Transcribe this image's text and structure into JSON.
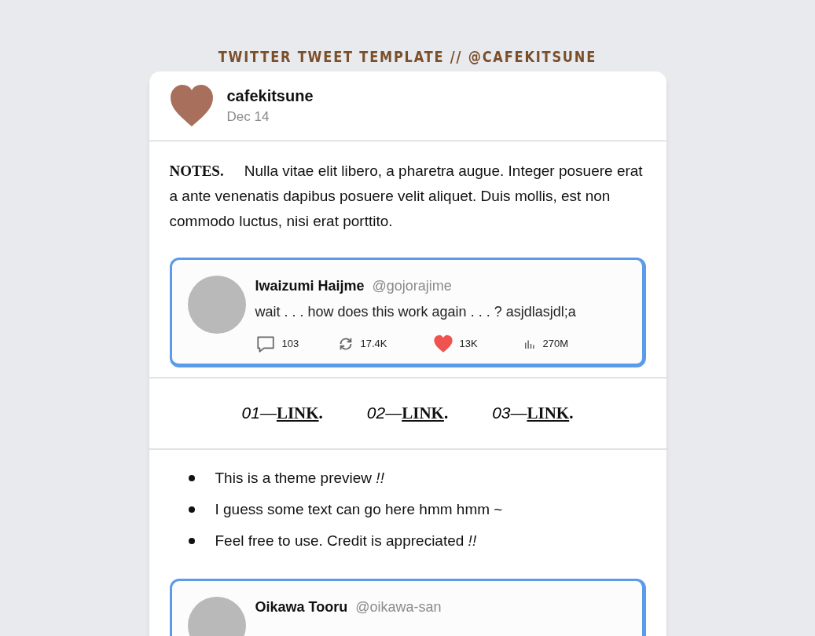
{
  "page_title": "TWITTER TWEET TEMPLATE // @CAFEKITSUNE",
  "post": {
    "author": "cafekitsune",
    "date": "Dec 14",
    "notes": {
      "label": "NOTES.",
      "text": "Nulla vitae elit libero, a pharetra augue. Integer posuere erat a ante venenatis dapibus posuere velit aliquet. Duis mollis, est non commodo luctus, nisi erat porttito."
    },
    "quotes": [
      {
        "name": "Iwaizumi Haijme",
        "handle": "@gojorajime",
        "text": "wait . . . how does this work again . . . ? asjdlasjdl;a",
        "replies": "103",
        "retweets": "17.4K",
        "likes": "13K",
        "liked": true,
        "views": "270M"
      },
      {
        "name": "Oikawa Tooru",
        "handle": "@oikawa-san"
      }
    ],
    "links": [
      {
        "number": "01—",
        "label": "LINK",
        "suffix": "."
      },
      {
        "number": "02—",
        "label": "LINK",
        "suffix": "."
      },
      {
        "number": "03—",
        "label": "LINK",
        "suffix": "."
      }
    ],
    "bullets": [
      "This is a theme preview *!!*",
      "I guess some text can go here hmm hmm ~",
      "Feel free to use. Credit is appreciated *!!*"
    ]
  }
}
